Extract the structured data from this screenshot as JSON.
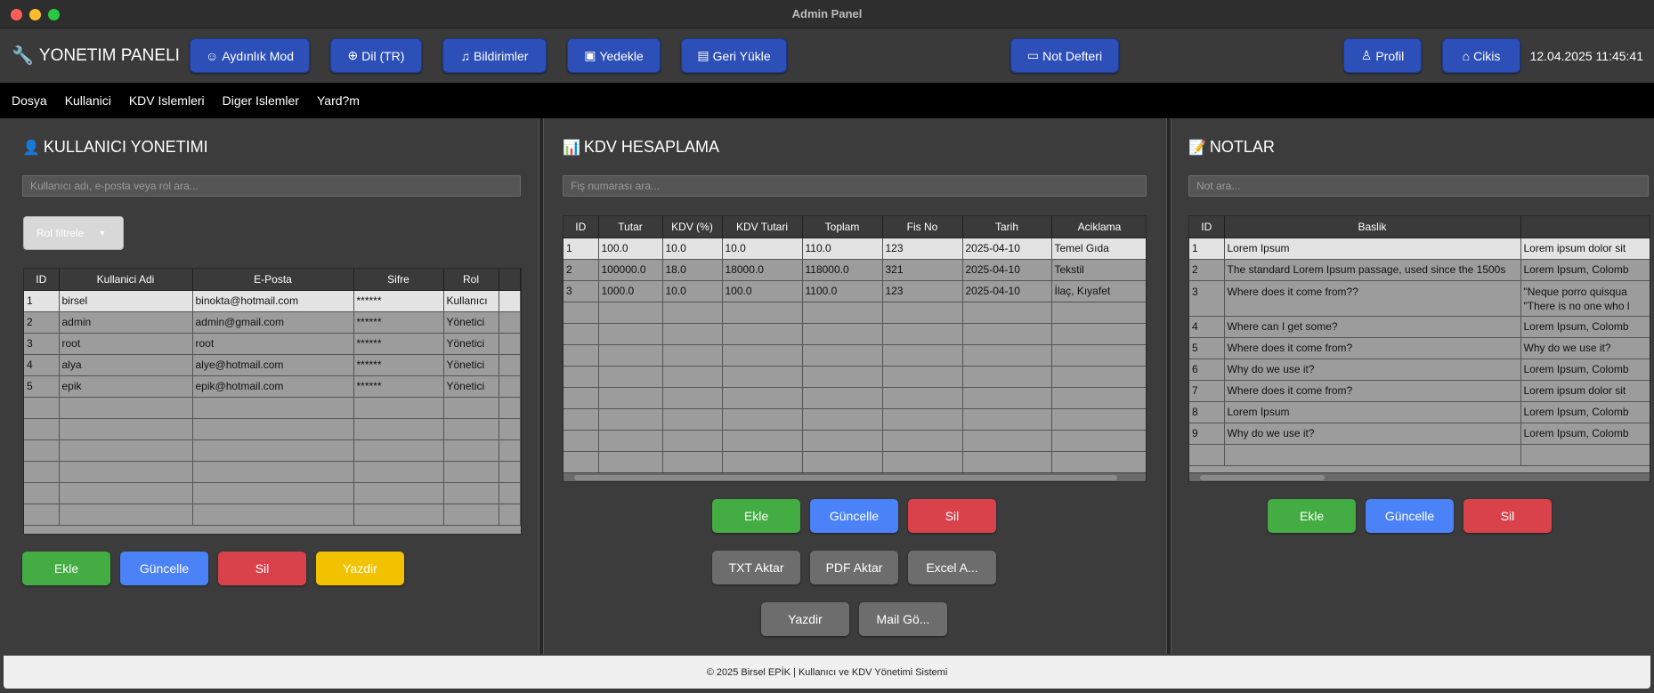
{
  "window": {
    "title": "Admin Panel"
  },
  "toolbar": {
    "brand": "YONETIM PANELI",
    "buttons": {
      "light_mode": "Aydınlık Mod",
      "language": "Dil (TR)",
      "notifications": "Bildirimler",
      "backup": "Yedekle",
      "restore": "Geri Yükle",
      "notepad": "Not Defteri",
      "profile": "Profil",
      "logout": "Cikis"
    },
    "datetime": "12.04.2025 11:45:41"
  },
  "menu": [
    "Dosya",
    "Kullanici",
    "KDV Islemleri",
    "Diger Islemler",
    "Yard?m"
  ],
  "users": {
    "title": "KULLANICI YONETIMI",
    "search_placeholder": "Kullanıcı adı, e-posta veya rol ara...",
    "role_filter": "Rol filtrele",
    "columns": [
      "ID",
      "Kullanici Adi",
      "E-Posta",
      "Sifre",
      "Rol"
    ],
    "rows": [
      [
        "1",
        "birsel",
        "binokta@hotmail.com",
        "******",
        "Kullanıcı"
      ],
      [
        "2",
        "admin",
        "admin@gmail.com",
        "******",
        "Yönetici"
      ],
      [
        "3",
        "root",
        "root",
        "******",
        "Yönetici"
      ],
      [
        "4",
        "alya",
        "alye@hotmail.com",
        "******",
        "Yönetici"
      ],
      [
        "5",
        "epik",
        "epik@hotmail.com",
        "******",
        "Yönetici"
      ]
    ],
    "buttons": {
      "add": "Ekle",
      "update": "Güncelle",
      "delete": "Sil",
      "print": "Yazdir"
    }
  },
  "kdv": {
    "title": "KDV HESAPLAMA",
    "search_placeholder": "Fiş numarası ara...",
    "columns": [
      "ID",
      "Tutar",
      "KDV (%)",
      "KDV Tutari",
      "Toplam",
      "Fis No",
      "Tarih",
      "Aciklama"
    ],
    "rows": [
      [
        "1",
        "100.0",
        "10.0",
        "10.0",
        "110.0",
        "123",
        "2025-04-10",
        "Temel Gıda"
      ],
      [
        "2",
        "100000.0",
        "18.0",
        "18000.0",
        "118000.0",
        "321",
        "2025-04-10",
        "Tekstil"
      ],
      [
        "3",
        "1000.0",
        "10.0",
        "100.0",
        "1100.0",
        "123",
        "2025-04-10",
        "İlaç, Kıyafet"
      ]
    ],
    "buttons": {
      "add": "Ekle",
      "update": "Güncelle",
      "delete": "Sil",
      "txt": "TXT Aktar",
      "pdf": "PDF Aktar",
      "excel": "Excel A...",
      "print": "Yazdir",
      "mail": "Mail Gö..."
    }
  },
  "notes": {
    "title": "NOTLAR",
    "search_placeholder": "Not ara...",
    "columns": [
      "ID",
      "Baslik",
      ""
    ],
    "rows": [
      [
        "1",
        "Lorem Ipsum",
        "Lorem ipsum dolor sit"
      ],
      [
        "2",
        "The standard Lorem Ipsum passage, used since the 1500s",
        "Lorem Ipsum, Colomb"
      ],
      [
        "3",
        "Where does it come from??",
        "\"Neque porro quisqua\n\"There is no one who l"
      ],
      [
        "4",
        "Where can I get some?",
        "Lorem Ipsum, Colomb"
      ],
      [
        "5",
        "Where does it come from?",
        "Why do we use it?"
      ],
      [
        "6",
        "Why do we use it?",
        "Lorem Ipsum, Colomb"
      ],
      [
        "7",
        "Where does it come from?",
        "Lorem ipsum dolor sit"
      ],
      [
        "8",
        "Lorem Ipsum",
        "Lorem Ipsum, Colomb"
      ],
      [
        "9",
        "Why do we use it?",
        "Lorem Ipsum, Colomb"
      ]
    ],
    "buttons": {
      "add": "Ekle",
      "update": "Güncelle",
      "delete": "Sil"
    }
  },
  "footer": "© 2025 Birsel EPİK | Kullanıcı ve KDV Yönetimi Sistemi"
}
